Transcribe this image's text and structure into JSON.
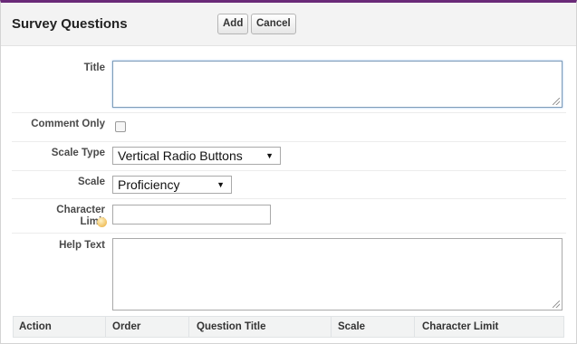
{
  "header": {
    "title": "Survey Questions",
    "add_label": "Add",
    "cancel_label": "Cancel"
  },
  "form": {
    "title_label": "Title",
    "title_value": "",
    "comment_only_label": "Comment Only",
    "comment_only_checked": false,
    "scale_type_label": "Scale Type",
    "scale_type_value": "Vertical Radio Buttons",
    "scale_label": "Scale",
    "scale_value": "Proficiency",
    "char_limit_label_line1": "Character",
    "char_limit_label_line2": "Limit",
    "char_limit_value": "",
    "help_text_label": "Help Text",
    "help_text_value": ""
  },
  "table": {
    "columns": [
      "Action",
      "Order",
      "Question Title",
      "Scale",
      "Character Limit"
    ]
  },
  "colors": {
    "accent_border": "#6a2a78",
    "focus_border": "#7f9db9"
  }
}
